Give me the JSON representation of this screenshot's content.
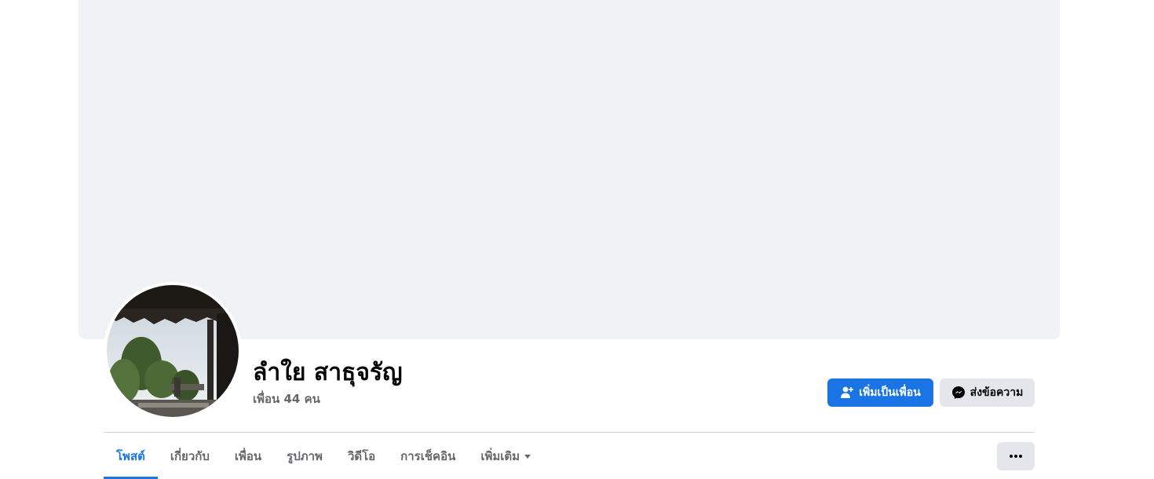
{
  "profile": {
    "name": "ลำใย สาธุจรัญ",
    "friends_count": "เพื่อน 44 คน"
  },
  "actions": {
    "add_friend_label": "เพิ่มเป็นเพื่อน",
    "message_label": "ส่งข้อความ",
    "add_friend_icon": "add-friend-icon",
    "message_icon": "messenger-icon",
    "more_icon": "ellipsis-icon"
  },
  "tabs": [
    {
      "label": "โพสต์",
      "active": true
    },
    {
      "label": "เกี่ยวกับ"
    },
    {
      "label": "เพื่อน"
    },
    {
      "label": "รูปภาพ"
    },
    {
      "label": "วิดีโอ"
    },
    {
      "label": "การเช็คอิน"
    },
    {
      "label": "เพิ่มเติม",
      "dropdown": true
    }
  ],
  "colors": {
    "accent": "#1b74e4",
    "cover_background": "#f0f2f5",
    "secondary_button": "#e4e6eb",
    "muted_text": "#65676b"
  }
}
